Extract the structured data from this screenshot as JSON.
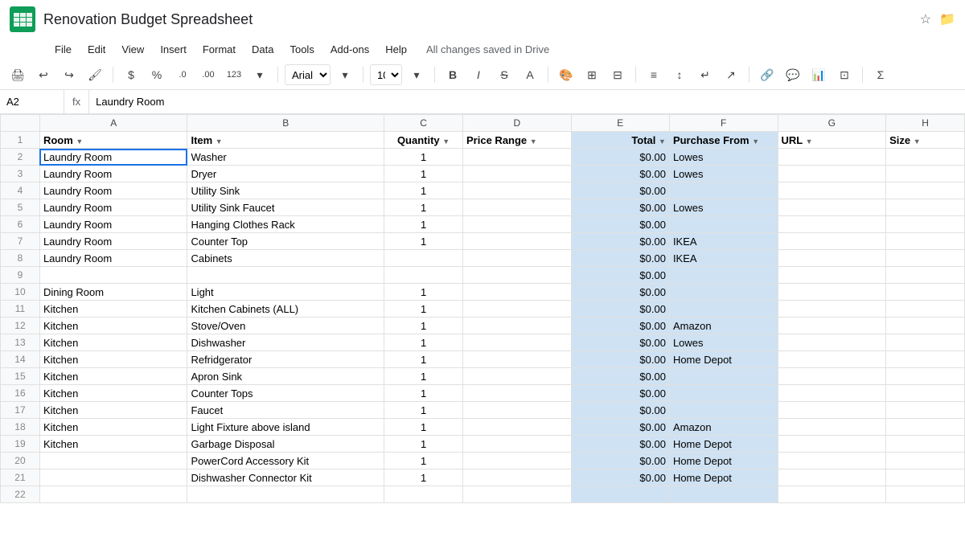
{
  "titleBar": {
    "logo": "sheets-logo",
    "title": "Renovation Budget Spreadsheet",
    "starIcon": "☆",
    "folderIcon": "📁"
  },
  "menuBar": {
    "items": [
      "File",
      "Insert",
      "View",
      "Insert",
      "Format",
      "Data",
      "Tools",
      "Add-ons",
      "Help"
    ],
    "savedMessage": "All changes saved in Drive"
  },
  "formulaBar": {
    "cellRef": "A2",
    "content": "Laundry  Room",
    "fx": "fx"
  },
  "columns": {
    "headers": [
      "",
      "A",
      "B",
      "C",
      "D",
      "E",
      "F",
      "G",
      "H"
    ],
    "labels": [
      "",
      "Room",
      "Item",
      "Quantity",
      "Price Range",
      "Total",
      "Purchase From",
      "URL",
      "Size"
    ]
  },
  "rows": [
    {
      "num": 1,
      "a": "Room",
      "b": "Item",
      "c": "Quantity",
      "d": "Price Range",
      "e": "Total",
      "f": "Purchase From",
      "g": "URL",
      "h": "Size",
      "isHeader": true
    },
    {
      "num": 2,
      "a": "Laundry Room",
      "b": "Washer",
      "c": "1",
      "d": "",
      "e": "$0.00",
      "f": "Lowes",
      "g": "",
      "h": "",
      "selectedA": true
    },
    {
      "num": 3,
      "a": "Laundry Room",
      "b": "Dryer",
      "c": "1",
      "d": "",
      "e": "$0.00",
      "f": "Lowes",
      "g": "",
      "h": ""
    },
    {
      "num": 4,
      "a": "Laundry Room",
      "b": "Utility Sink",
      "c": "1",
      "d": "",
      "e": "$0.00",
      "f": "",
      "g": "",
      "h": ""
    },
    {
      "num": 5,
      "a": "Laundry Room",
      "b": "Utility Sink Faucet",
      "c": "1",
      "d": "",
      "e": "$0.00",
      "f": "Lowes",
      "g": "",
      "h": ""
    },
    {
      "num": 6,
      "a": "Laundry Room",
      "b": "Hanging Clothes Rack",
      "c": "1",
      "d": "",
      "e": "$0.00",
      "f": "",
      "g": "",
      "h": ""
    },
    {
      "num": 7,
      "a": "Laundry Room",
      "b": "Counter Top",
      "c": "1",
      "d": "",
      "e": "$0.00",
      "f": "IKEA",
      "g": "",
      "h": ""
    },
    {
      "num": 8,
      "a": "Laundry Room",
      "b": "Cabinets",
      "c": "",
      "d": "",
      "e": "$0.00",
      "f": "IKEA",
      "g": "",
      "h": ""
    },
    {
      "num": 9,
      "a": "",
      "b": "",
      "c": "",
      "d": "",
      "e": "$0.00",
      "f": "",
      "g": "",
      "h": ""
    },
    {
      "num": 10,
      "a": "Dining Room",
      "b": "Light",
      "c": "1",
      "d": "",
      "e": "$0.00",
      "f": "",
      "g": "",
      "h": ""
    },
    {
      "num": 11,
      "a": "Kitchen",
      "b": "Kitchen Cabinets (ALL)",
      "c": "1",
      "d": "",
      "e": "$0.00",
      "f": "",
      "g": "",
      "h": ""
    },
    {
      "num": 12,
      "a": "Kitchen",
      "b": "Stove/Oven",
      "c": "1",
      "d": "",
      "e": "$0.00",
      "f": "Amazon",
      "g": "",
      "h": ""
    },
    {
      "num": 13,
      "a": "Kitchen",
      "b": "Dishwasher",
      "c": "1",
      "d": "",
      "e": "$0.00",
      "f": "Lowes",
      "g": "",
      "h": ""
    },
    {
      "num": 14,
      "a": "Kitchen",
      "b": "Refridgerator",
      "c": "1",
      "d": "",
      "e": "$0.00",
      "f": "Home Depot",
      "g": "",
      "h": ""
    },
    {
      "num": 15,
      "a": "Kitchen",
      "b": "Apron Sink",
      "c": "1",
      "d": "",
      "e": "$0.00",
      "f": "",
      "g": "",
      "h": ""
    },
    {
      "num": 16,
      "a": "Kitchen",
      "b": "Counter Tops",
      "c": "1",
      "d": "",
      "e": "$0.00",
      "f": "",
      "g": "",
      "h": ""
    },
    {
      "num": 17,
      "a": "Kitchen",
      "b": "Faucet",
      "c": "1",
      "d": "",
      "e": "$0.00",
      "f": "",
      "g": "",
      "h": ""
    },
    {
      "num": 18,
      "a": "Kitchen",
      "b": "Light Fixture above island",
      "c": "1",
      "d": "",
      "e": "$0.00",
      "f": "Amazon",
      "g": "",
      "h": ""
    },
    {
      "num": 19,
      "a": "Kitchen",
      "b": "Garbage Disposal",
      "c": "1",
      "d": "",
      "e": "$0.00",
      "f": "Home Depot",
      "g": "",
      "h": ""
    },
    {
      "num": 20,
      "a": "",
      "b": "PowerCord Accessory Kit",
      "c": "1",
      "d": "",
      "e": "$0.00",
      "f": "Home Depot",
      "g": "",
      "h": ""
    },
    {
      "num": 21,
      "a": "",
      "b": "Dishwasher Connector Kit",
      "c": "1",
      "d": "",
      "e": "$0.00",
      "f": "Home Depot",
      "g": "",
      "h": ""
    },
    {
      "num": 22,
      "a": "",
      "b": "",
      "c": "",
      "d": "",
      "e": "",
      "f": "",
      "g": "",
      "h": ""
    }
  ]
}
